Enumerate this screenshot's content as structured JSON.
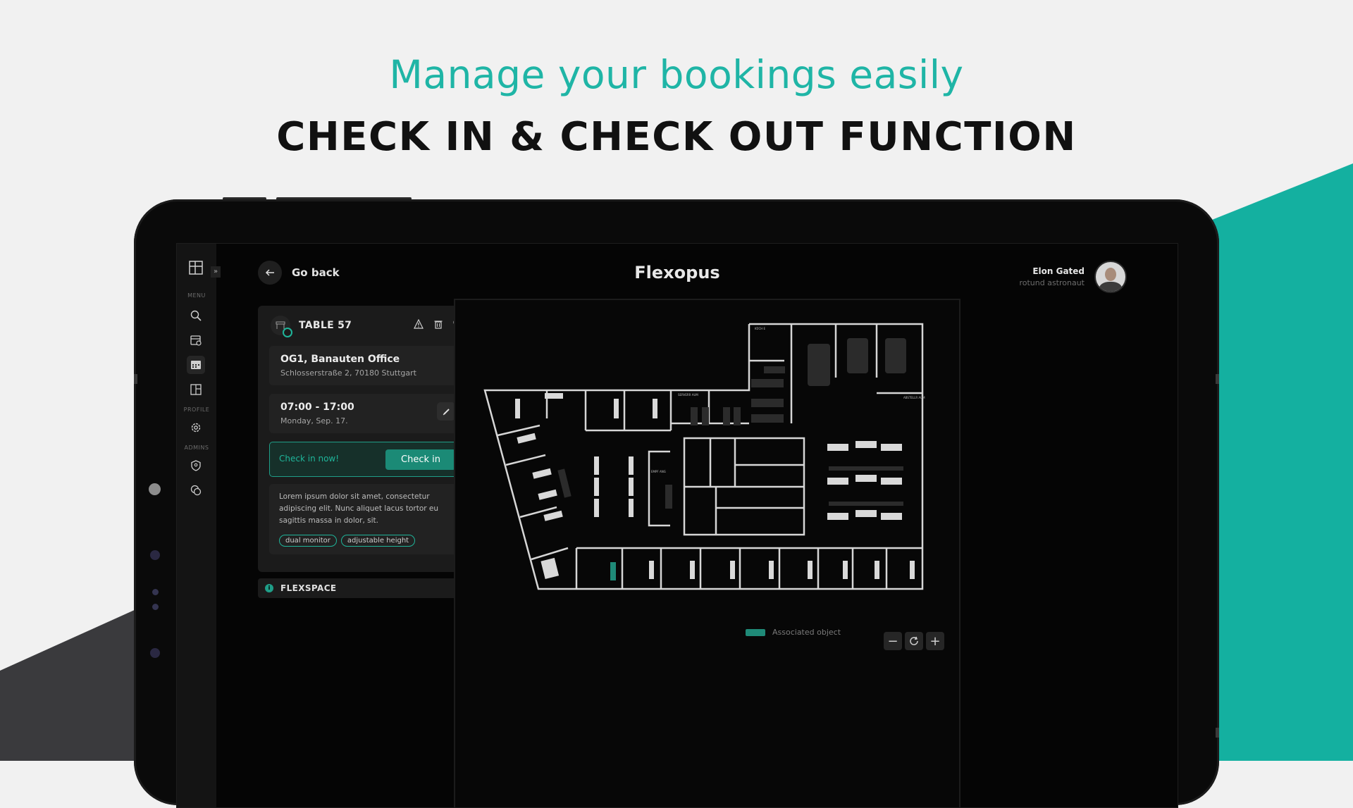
{
  "marketing": {
    "tagline": "Manage your bookings easily",
    "headline": "CHECK IN & CHECK OUT FUNCTION"
  },
  "colors": {
    "accent": "#1fb5a6",
    "checkin": "#1b8a76",
    "associated": "#1f8a78"
  },
  "app": {
    "brand": "Flexopus",
    "go_back_label": "Go back",
    "user": {
      "name": "Elon Gated",
      "role": "rotund astronaut"
    },
    "sidebar": {
      "sections": {
        "menu": "MENU",
        "profile": "PROFILE",
        "admins": "ADMINS"
      },
      "items": [
        {
          "icon": "search-icon"
        },
        {
          "icon": "calendar-check-icon"
        },
        {
          "icon": "calendar-icon",
          "active": true
        },
        {
          "icon": "floorplan-icon"
        },
        {
          "icon": "gear-icon"
        },
        {
          "icon": "shield-user-icon"
        },
        {
          "icon": "chat-icon"
        }
      ]
    },
    "booking": {
      "title": "TABLE 57",
      "location_name": "OG1, Banauten Office",
      "address": "Schlosserstraße 2, 70180 Stuttgart",
      "time": "07:00 - 17:00",
      "date": "Monday, Sep. 17.",
      "checkin_prompt": "Check in now!",
      "checkin_button": "Check in",
      "description": "Lorem ipsum dolor sit amet, consectetur adipiscing elit. Nunc aliquet lacus tortor eu sagittis massa in dolor, sit.",
      "tags": [
        "dual monitor",
        "adjustable height"
      ],
      "area": "FLEXSPACE",
      "area_badge": "i"
    },
    "map": {
      "legend_label": "Associated object",
      "room_labels": [
        "KÜCH E",
        "SERVERR AUM",
        "ABSTELLR AUM",
        "EMPF ANG"
      ],
      "zoom_out": "−",
      "zoom_reset": "reset-icon",
      "zoom_in": "+"
    }
  }
}
